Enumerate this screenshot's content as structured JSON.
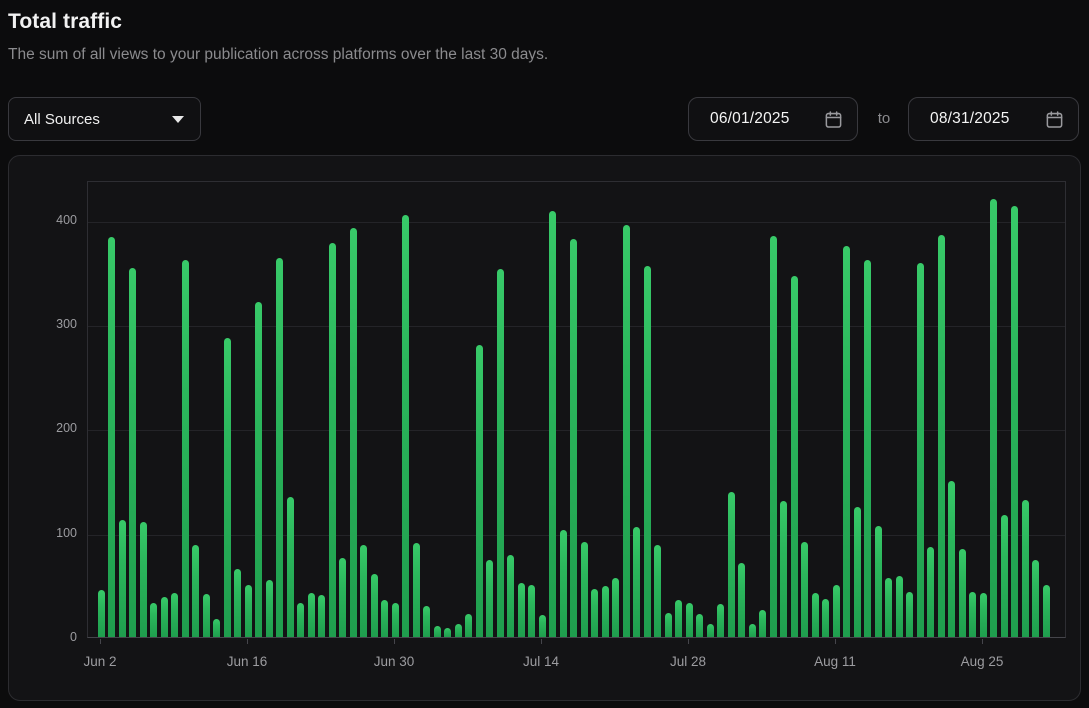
{
  "header": {
    "title": "Total traffic",
    "subtitle": "The sum of all views to your publication across platforms over the last 30 days."
  },
  "controls": {
    "source_filter": {
      "value": "All Sources",
      "icon": "caret-down-icon"
    },
    "date_range": {
      "start_value": "06/01/2025",
      "separator": "to",
      "end_value": "08/31/2025",
      "icon": "calendar-icon",
      "icon_color": "#9a9a9e"
    }
  },
  "chart_data": {
    "type": "bar",
    "title": "Total traffic",
    "xlabel": "",
    "ylabel": "",
    "ylim": [
      0,
      438
    ],
    "yticks": [
      0,
      100,
      200,
      300,
      400
    ],
    "grid": true,
    "legend": "none",
    "bar_color": "#2bb65c",
    "bar_gradient_top": "#38ca69",
    "bar_gradient_bottom": "#1f9e4e",
    "x": [
      "Jun 2",
      "Jun 3",
      "Jun 4",
      "Jun 5",
      "Jun 6",
      "Jun 7",
      "Jun 8",
      "Jun 9",
      "Jun 10",
      "Jun 11",
      "Jun 12",
      "Jun 13",
      "Jun 14",
      "Jun 15",
      "Jun 16",
      "Jun 17",
      "Jun 18",
      "Jun 19",
      "Jun 20",
      "Jun 21",
      "Jun 22",
      "Jun 23",
      "Jun 24",
      "Jun 25",
      "Jun 26",
      "Jun 27",
      "Jun 28",
      "Jun 29",
      "Jun 30",
      "Jul 1",
      "Jul 2",
      "Jul 3",
      "Jul 4",
      "Jul 5",
      "Jul 6",
      "Jul 7",
      "Jul 8",
      "Jul 9",
      "Jul 10",
      "Jul 11",
      "Jul 12",
      "Jul 13",
      "Jul 14",
      "Jul 15",
      "Jul 16",
      "Jul 17",
      "Jul 18",
      "Jul 19",
      "Jul 20",
      "Jul 21",
      "Jul 22",
      "Jul 23",
      "Jul 24",
      "Jul 25",
      "Jul 26",
      "Jul 27",
      "Jul 28",
      "Jul 29",
      "Jul 30",
      "Jul 31",
      "Aug 1",
      "Aug 2",
      "Aug 3",
      "Aug 4",
      "Aug 5",
      "Aug 6",
      "Aug 7",
      "Aug 8",
      "Aug 9",
      "Aug 10",
      "Aug 11",
      "Aug 12",
      "Aug 13",
      "Aug 14",
      "Aug 15",
      "Aug 16",
      "Aug 17",
      "Aug 18",
      "Aug 19",
      "Aug 20",
      "Aug 21",
      "Aug 22",
      "Aug 23",
      "Aug 24",
      "Aug 25",
      "Aug 26",
      "Aug 27",
      "Aug 28",
      "Aug 29",
      "Aug 30",
      "Aug 31"
    ],
    "values": [
      45,
      383,
      112,
      354,
      110,
      33,
      38,
      42,
      361,
      88,
      41,
      17,
      287,
      65,
      50,
      321,
      55,
      363,
      134,
      33,
      42,
      40,
      378,
      76,
      392,
      88,
      60,
      35,
      33,
      404,
      90,
      30,
      11,
      9,
      12,
      22,
      280,
      74,
      353,
      79,
      52,
      50,
      21,
      408,
      103,
      381,
      91,
      46,
      49,
      57,
      395,
      105,
      356,
      88,
      23,
      35,
      33,
      22,
      12,
      32,
      139,
      71,
      12,
      26,
      384,
      130,
      346,
      91,
      42,
      36,
      50,
      375,
      125,
      361,
      106,
      57,
      58,
      43,
      358,
      86,
      385,
      150,
      84,
      43,
      42,
      420,
      117,
      413,
      131,
      74,
      50
    ],
    "xtick_labels": [
      "Jun 2",
      "Jun 16",
      "Jun 30",
      "Jul 14",
      "Jul 28",
      "Aug 11",
      "Aug 25"
    ],
    "xtick_indices": [
      0,
      14,
      28,
      42,
      56,
      70,
      84
    ]
  }
}
